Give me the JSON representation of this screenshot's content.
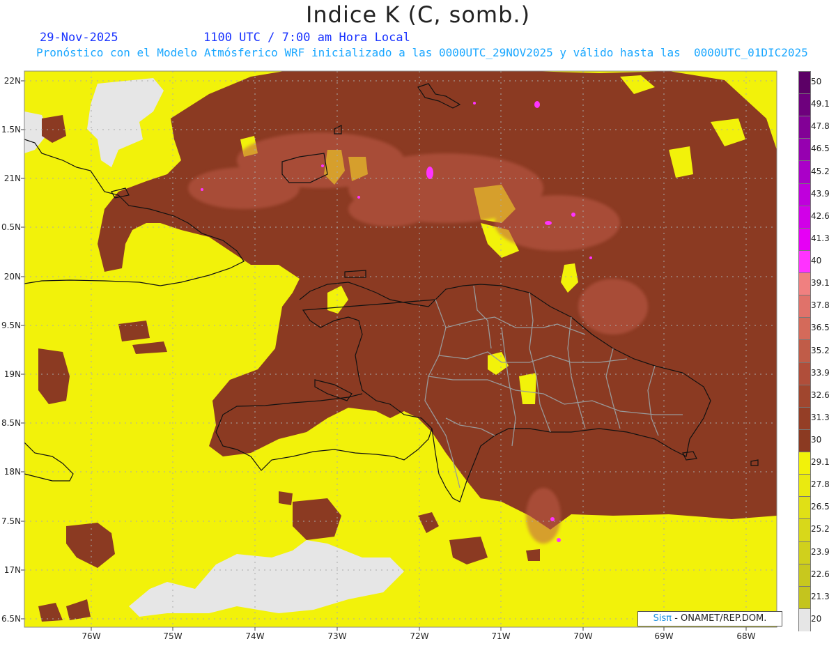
{
  "header": {
    "title": "Indice K (C, somb.)",
    "date": "29-Nov-2025",
    "time": "1100 UTC / 7:00 am Hora Local",
    "description": "Pronóstico con el Modelo Atmósferico WRF inicializado a las 0000UTC_29NOV2025 y válido hasta las  0000UTC_01DIC2025"
  },
  "map": {
    "lat_labels": [
      "22N",
      "1.5N",
      "21N",
      "0.5N",
      "20N",
      "9.5N",
      "19N",
      "8.5N",
      "18N",
      "7.5N",
      "17N",
      "6.5N"
    ],
    "lon_labels": [
      "76W",
      "75W",
      "74W",
      "73W",
      "72W",
      "71W",
      "70W",
      "69W",
      "68W"
    ],
    "colors": {
      "low_yellow": "#f2f20a",
      "no_data": "#e6e6e6",
      "high_brown": "#8b3a22",
      "hotspot": "#ff33ff",
      "coastline": "#111111",
      "provinces": "#999999"
    }
  },
  "colorbar": {
    "labels": [
      "50",
      "49.1",
      "47.8",
      "46.5",
      "45.2",
      "43.9",
      "42.6",
      "41.3",
      "40",
      "39.1",
      "37.8",
      "36.5",
      "35.2",
      "33.9",
      "32.6",
      "31.3",
      "30",
      "29.1",
      "27.8",
      "26.5",
      "25.2",
      "23.9",
      "22.6",
      "21.3",
      "20"
    ],
    "colors": [
      "#5c0066",
      "#6e007d",
      "#820096",
      "#9600b0",
      "#aa00c8",
      "#bf00dc",
      "#d100e8",
      "#e600f5",
      "#ff33ff",
      "#f08080",
      "#e0726a",
      "#d46a5a",
      "#c05c48",
      "#b04e3a",
      "#a0462e",
      "#943e26",
      "#8b3a22",
      "#f2f20a",
      "#eaea10",
      "#e0e016",
      "#d8d81a",
      "#d0d01c",
      "#c8c81e",
      "#c4c41e",
      "#e6e6e6"
    ]
  },
  "credit": {
    "logo": "Sisπ",
    "text": " -  ONAMET/REP.DOM."
  }
}
